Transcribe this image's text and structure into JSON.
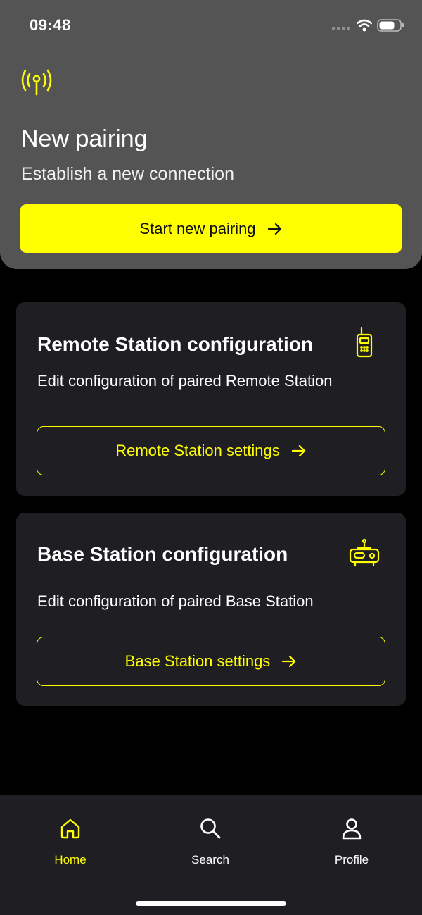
{
  "status_bar": {
    "time": "09:48"
  },
  "pairing": {
    "title": "New pairing",
    "subtitle": "Establish a new connection",
    "button_label": "Start new pairing"
  },
  "remote_card": {
    "title": "Remote Station configuration",
    "description": "Edit configuration of paired Remote Station",
    "button_label": "Remote Station settings"
  },
  "base_card": {
    "title": "Base Station configuration",
    "description": "Edit configuration of paired Base Station",
    "button_label": "Base Station settings"
  },
  "nav": {
    "items": [
      {
        "label": "Home",
        "icon": "home-icon",
        "active": true
      },
      {
        "label": "Search",
        "icon": "search-icon",
        "active": false
      },
      {
        "label": "Profile",
        "icon": "profile-icon",
        "active": false
      }
    ]
  },
  "colors": {
    "accent": "#ffff00",
    "panel": "#545454",
    "card": "#1f1f23",
    "background": "#000000"
  }
}
